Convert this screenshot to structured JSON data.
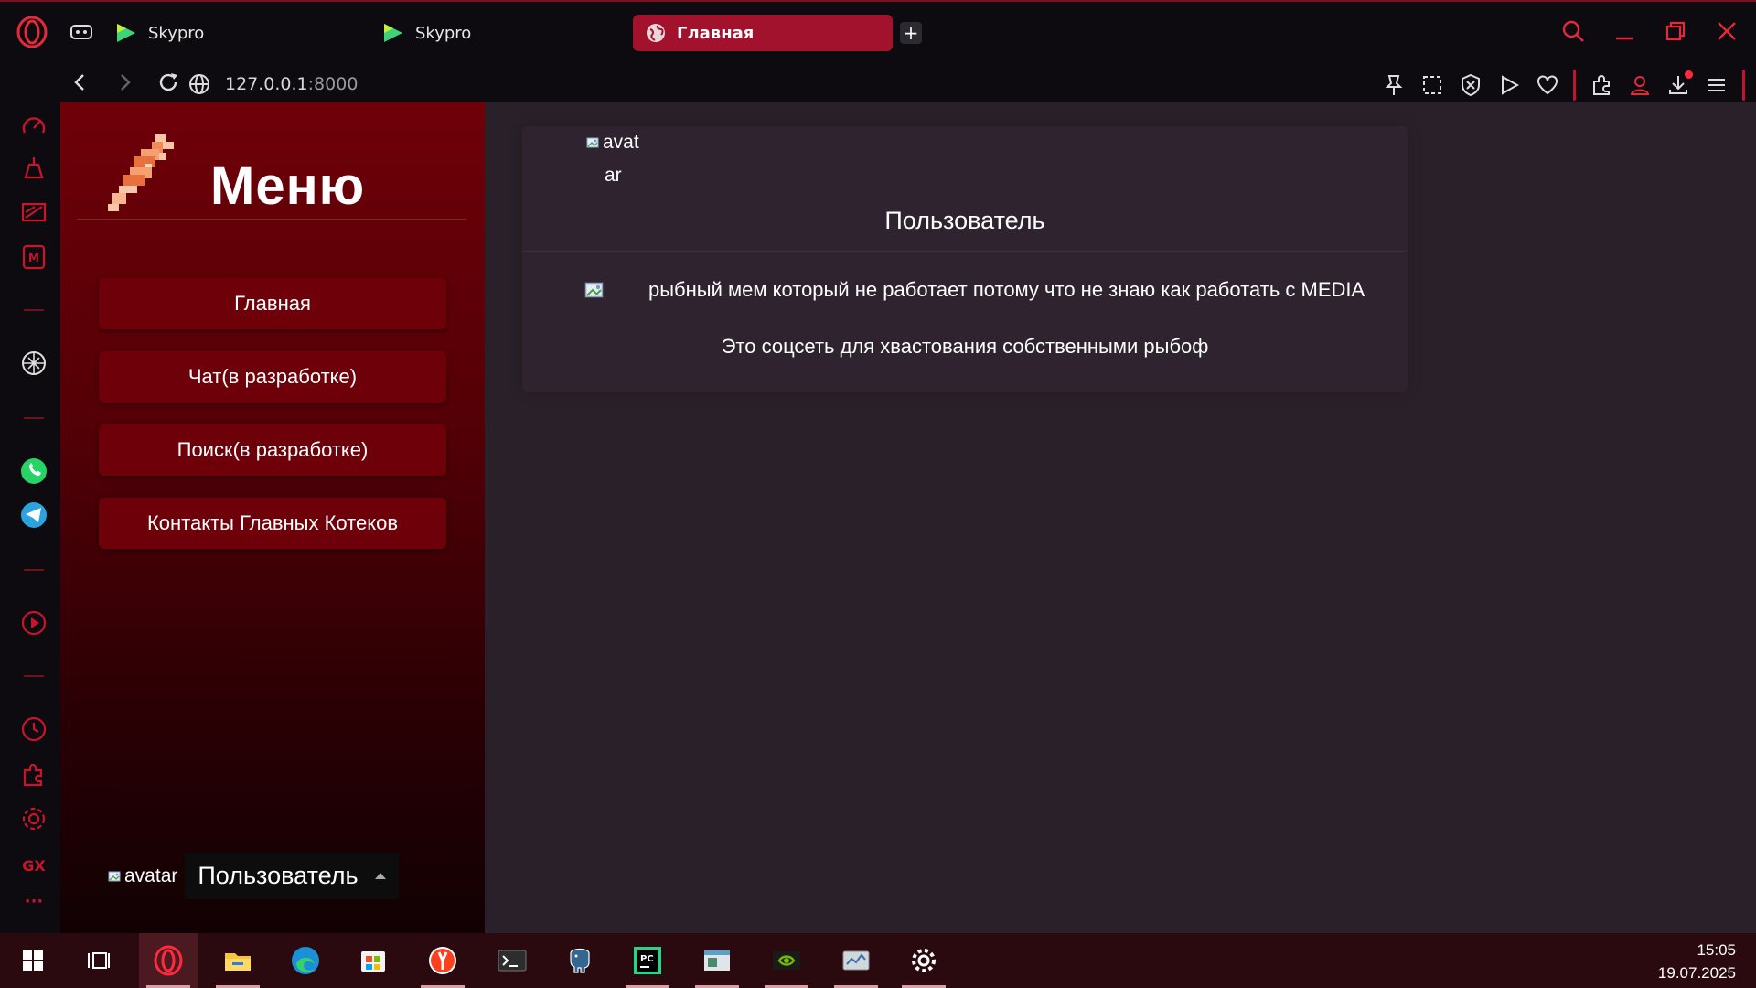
{
  "browser": {
    "tabs": [
      {
        "label": "Skypro"
      },
      {
        "label": "Skypro"
      },
      {
        "label": "Главная"
      }
    ],
    "new_tab": "+",
    "url_host": "127.0.0.1",
    "url_port": ":8000"
  },
  "menu": {
    "title": "Меню",
    "buttons": [
      {
        "label": "Главная"
      },
      {
        "label": "Чат(в разработке)"
      },
      {
        "label": "Поиск(в разработке)"
      },
      {
        "label": "Контакты Главных Котеков"
      }
    ],
    "avatar_alt": "avatar",
    "user_label": "Пользователь"
  },
  "profile": {
    "avatar_alt_line1": "avat",
    "avatar_alt_line2": "ar",
    "title": "Пользователь",
    "meme_text": "рыбный мем который не работает потому что не знаю как работать с MEDIA",
    "description": "Это соцсеть для хвастования собственными рыбоф"
  },
  "sidebar": {
    "bottom_label": "GX",
    "more": "···"
  },
  "clock": {
    "time": "15:05",
    "date": "19.07.2025"
  },
  "colors": {
    "accent": "#a3122c",
    "menu_top": "#6f0008",
    "page_bg": "#2a2029",
    "button_bg": "#6d0008"
  }
}
